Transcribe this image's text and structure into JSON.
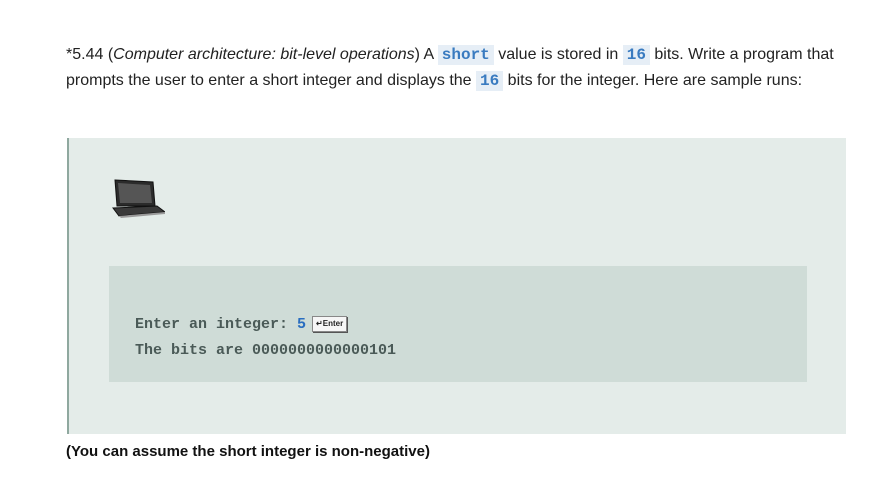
{
  "problem": {
    "number": "*5.44",
    "title": "Computer architecture: bit-level operations",
    "text_a": " A ",
    "keyword": "short",
    "text_b": " value is stored in ",
    "bits1": "16",
    "text_c": " bits. Write a program that prompts the user to enter a short integer and displays the ",
    "bits2": "16",
    "text_d": " bits for the integer. Here are sample runs:"
  },
  "sample": {
    "prompt": "Enter an integer: ",
    "input": "5",
    "enter_key": "↵Enter",
    "output": "The bits are 0000000000000101",
    "laptop_icon": "laptop-icon"
  },
  "note": "(You can assume the short integer is non-negative)"
}
